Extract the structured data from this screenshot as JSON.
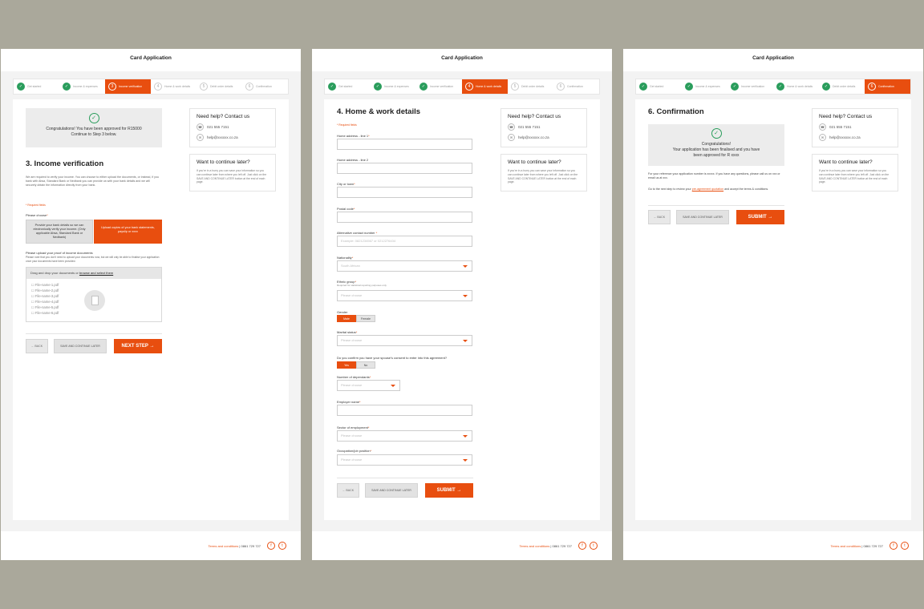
{
  "app_title": "Card Application",
  "steps": [
    {
      "label": "Get started",
      "num": "1"
    },
    {
      "label": "Income & expenses",
      "num": "2"
    },
    {
      "label": "Income verification",
      "num": "3"
    },
    {
      "label": "Home & work details",
      "num": "4"
    },
    {
      "label": "Debit order details",
      "num": "5"
    },
    {
      "label": "Confirmation",
      "num": "6"
    }
  ],
  "help": {
    "title": "Need help? Contact us",
    "phone": "021 555 7151",
    "email": "help@xxxxxx.co.za"
  },
  "continue_later": {
    "title": "Want to continue later?",
    "text": "If you're in a hurry you can save your information so you can continue later from where you left off. Just click on the SAVE AND CONTINUE LATER button at the end of each page."
  },
  "buttons": {
    "back": "← BACK",
    "save": "SAVE AND CONTINUE LATER",
    "next": "NEXT STEP →",
    "submit": "SUBMIT →"
  },
  "footer": {
    "terms": "Terms and conditions",
    "phone": "| 0861 729 727"
  },
  "panel1": {
    "notice_line1": "Congratulations! You have been approved for R15000",
    "notice_line2": "Continue to Step 3 below.",
    "title": "3. Income verification",
    "intro": "We are required to verify your income. You can choose to either upload the documents, or instead, if you bank with Absa, Standard Bank or Nedbank you can provide us with your bank details and we will securely obtain the information directly from your bank.",
    "required": "* Required fields",
    "choose_label": "Please choose",
    "option1": "Provide your bank details so we can electronically verify your income. (Only applicable Absa, Standard Bank or Nedbank)",
    "option2": "Upload copies of your bank statements, payslip or xxxx",
    "upload_label": "Please upload your proof of income documents",
    "upload_hint": "Please note that you don't need to upload your documents now, but we will only be able to finalise your application once your documents have been provided.",
    "drop_text": "Drag and drop your documents or",
    "drop_link": "browse and select them",
    "files": [
      "File-name-1.pdf",
      "File-name-2.pdf",
      "File-name-3.pdf",
      "File-name-4.pdf",
      "File-name-5.pdf",
      "File-name-6.pdf"
    ]
  },
  "panel2": {
    "title": "4. Home & work details",
    "required": "* Required fields",
    "fields": {
      "addr1": {
        "label": "Home address - line 1",
        "value": ""
      },
      "addr2": {
        "label": "Home address - line 2",
        "value": ""
      },
      "city": {
        "label": "City or town",
        "value": ""
      },
      "postal": {
        "label": "Postal code",
        "value": ""
      },
      "alt": {
        "label": "Alternative contact number",
        "placeholder": "Example: 0821234567 or 0212276434"
      },
      "nationality": {
        "label": "Nationality",
        "value": "South African"
      },
      "ethnic": {
        "label": "Ethnic group",
        "hint": "Required for statistical reporting purposes only",
        "value": "Please choose"
      },
      "gender": {
        "label": "Gender",
        "opt1": "Male",
        "opt2": "Female"
      },
      "marital": {
        "label": "Marital status",
        "value": "Please choose"
      },
      "consent": {
        "label": "Do you confirm you have your spouse's consent to enter into this agreement?",
        "opt1": "Yes",
        "opt2": "No"
      },
      "dependants": {
        "label": "Number of dependants",
        "value": "Please choose"
      },
      "employer": {
        "label": "Employer name",
        "value": ""
      },
      "sector": {
        "label": "Sector of employment",
        "value": "Please choose"
      },
      "occupation": {
        "label": "Occupation/job position",
        "value": "Please choose"
      }
    }
  },
  "panel3": {
    "title": "6. Confirmation",
    "notice_line1": "Congratulations!",
    "notice_line2": "Your application has been finalised and you have",
    "notice_line3": "been approved for R xxxx",
    "ref_text": "For your reference your application number is xxxxx. If you have any questions, please call us on xxx or email us at xxx.",
    "next_text": "Go to the next step to review your",
    "next_link": "pre-agreement quotation",
    "next_text2": "and accept the terms & conditions."
  },
  "colors": {
    "accent": "#e84e0f",
    "success": "#2a9d5c"
  }
}
